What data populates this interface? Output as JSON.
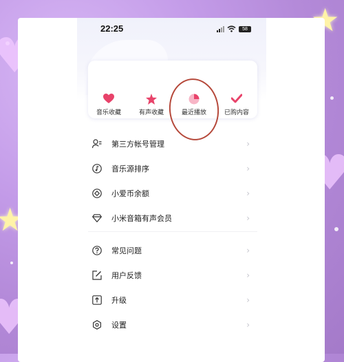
{
  "status_bar": {
    "time": "22:25",
    "battery": "58"
  },
  "quick_actions": [
    {
      "label": "音乐收藏",
      "icon": "heart-icon"
    },
    {
      "label": "有声收藏",
      "icon": "star-icon"
    },
    {
      "label": "最近播放",
      "icon": "clock-pie-icon"
    },
    {
      "label": "已购内容",
      "icon": "check-icon"
    }
  ],
  "menu_group1": [
    {
      "label": "第三方帐号管理",
      "icon": "account-link-icon"
    },
    {
      "label": "音乐源排序",
      "icon": "music-note-icon"
    },
    {
      "label": "小爱币余额",
      "icon": "coin-icon"
    },
    {
      "label": "小米音箱有声会员",
      "icon": "diamond-icon"
    }
  ],
  "menu_group2": [
    {
      "label": "常见问题",
      "icon": "question-icon"
    },
    {
      "label": "用户反馈",
      "icon": "edit-icon"
    },
    {
      "label": "升级",
      "icon": "upgrade-icon"
    },
    {
      "label": "设置",
      "icon": "settings-icon"
    }
  ],
  "chevron": "›",
  "colors": {
    "accent": "#e8436a",
    "annotation": "#b5483a"
  }
}
